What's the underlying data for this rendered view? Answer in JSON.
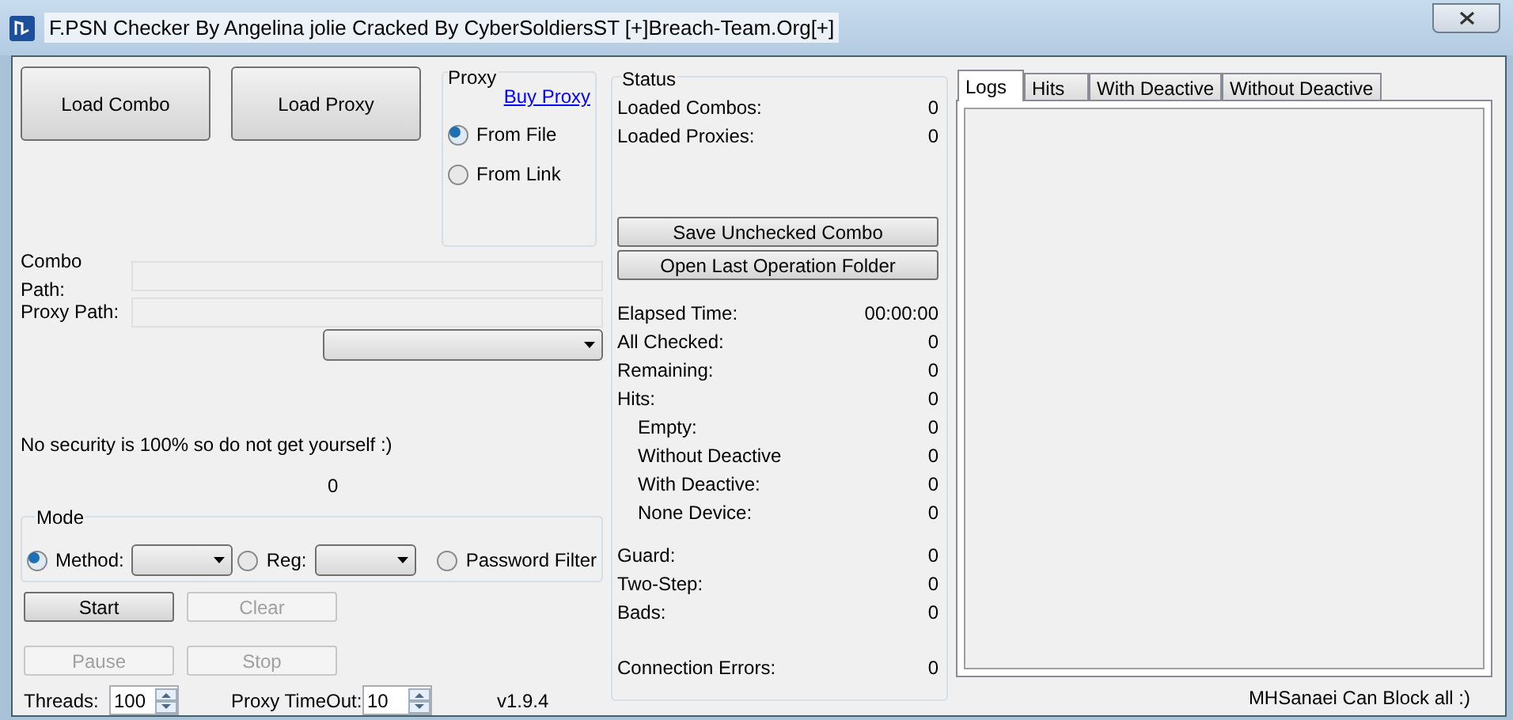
{
  "window": {
    "title": "F.PSN Checker By Angelina jolie Cracked By CyberSoldiersST [+]Breach-Team.Org[+]"
  },
  "load_buttons": [
    {
      "label": "Load Combo"
    },
    {
      "label": "Load Proxy"
    }
  ],
  "proxy": {
    "title": "Proxy",
    "link": "Buy Proxy",
    "options": [
      {
        "label": "From File",
        "selected": true
      },
      {
        "label": "From Link",
        "selected": false
      }
    ]
  },
  "paths": [
    {
      "label": "Combo Path:"
    },
    {
      "label": "Proxy Path:"
    }
  ],
  "notice": "No security is 100% so do not get yourself :)",
  "counter": "0",
  "mode": {
    "title": "Mode",
    "options": [
      {
        "kind": "dropdown",
        "label": "Method:",
        "selected": true
      },
      {
        "kind": "dropdown",
        "label": "Reg:",
        "selected": false
      },
      {
        "kind": "plain",
        "label": "Password Filter",
        "selected": false
      }
    ]
  },
  "actions": [
    {
      "label": "Start",
      "disabled": false
    },
    {
      "label": "Clear",
      "disabled": true
    },
    {
      "label": "Pause",
      "disabled": true
    },
    {
      "label": "Stop",
      "disabled": true
    }
  ],
  "threads": {
    "label": "Threads:",
    "value": "100"
  },
  "timeout": {
    "label": "Proxy TimeOut:",
    "value": "10"
  },
  "version": "v1.9.4",
  "status": {
    "title": "Status",
    "loaded": [
      {
        "label": "Loaded Combos:",
        "value": "0"
      },
      {
        "label": "Loaded Proxies:",
        "value": "0"
      }
    ],
    "buttons": [
      "Save Unchecked Combo",
      "Open Last Operation Folder"
    ],
    "groups": [
      [
        {
          "label": "Elapsed Time:",
          "value": "00:00:00"
        },
        {
          "label": "All Checked:",
          "value": "0"
        },
        {
          "label": "Remaining:",
          "value": "0"
        },
        {
          "label": "Hits:",
          "value": "0",
          "children": [
            {
              "label": "Empty:",
              "value": "0"
            },
            {
              "label": "Without Deactive",
              "value": "0"
            },
            {
              "label": "With Deactive:",
              "value": "0"
            },
            {
              "label": "None Device:",
              "value": "0"
            }
          ]
        }
      ],
      [
        {
          "label": "Guard:",
          "value": "0"
        },
        {
          "label": "Two-Step:",
          "value": "0"
        },
        {
          "label": "Bads:",
          "value": "0"
        }
      ],
      [
        {
          "label": "Connection Errors:",
          "value": "0"
        }
      ]
    ]
  },
  "tabs": [
    {
      "label": "Logs",
      "selected": true
    },
    {
      "label": "Hits",
      "selected": false
    },
    {
      "label": "With Deactive",
      "selected": false
    },
    {
      "label": "Without Deactive",
      "selected": false
    }
  ],
  "footer": "MHSanaei Can Block all :)"
}
